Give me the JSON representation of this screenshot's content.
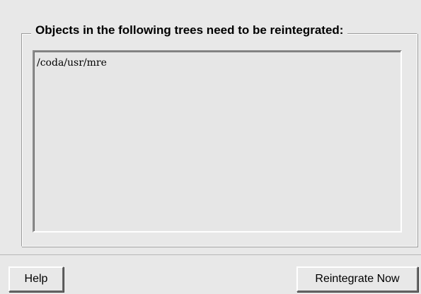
{
  "group": {
    "title": "Objects in the following trees need to be reintegrated:"
  },
  "tree_list": {
    "items": [
      "/coda/usr/mre"
    ]
  },
  "buttons": {
    "help_label": "Help",
    "reintegrate_label": "Reintegrate Now"
  }
}
